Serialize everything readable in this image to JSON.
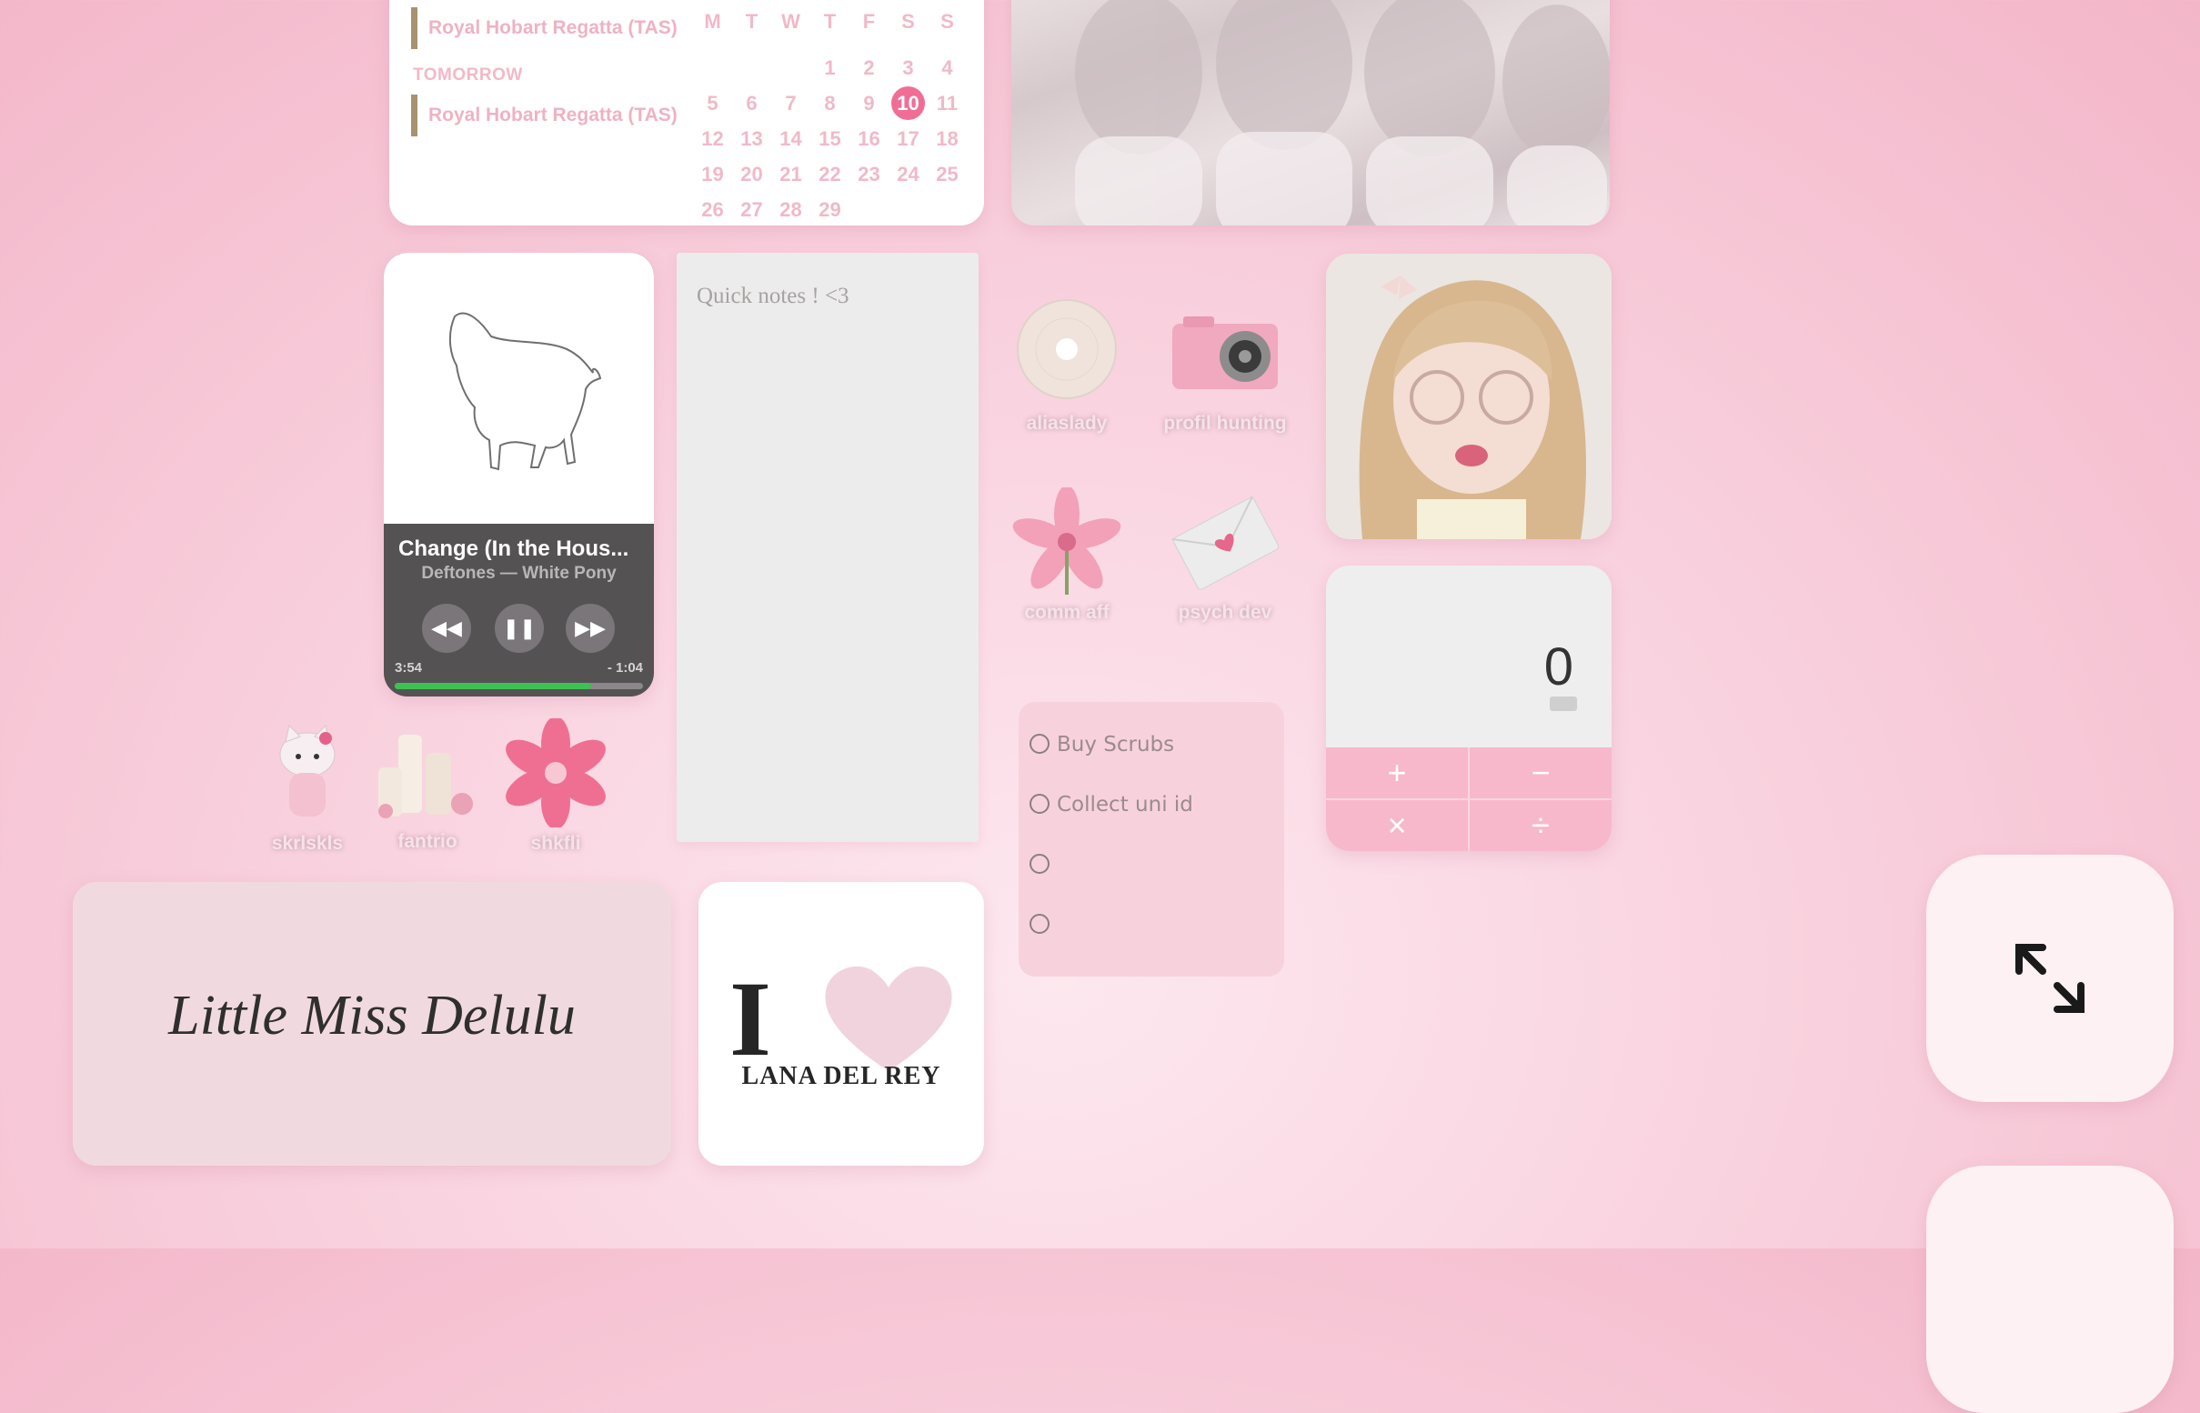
{
  "calendar": {
    "weekdays": [
      "M",
      "T",
      "W",
      "T",
      "F",
      "S",
      "S"
    ],
    "days": [
      "",
      "",
      "",
      "1",
      "2",
      "3",
      "4",
      "5",
      "6",
      "7",
      "8",
      "9",
      "10",
      "11",
      "12",
      "13",
      "14",
      "15",
      "16",
      "17",
      "18",
      "19",
      "20",
      "21",
      "22",
      "23",
      "24",
      "25",
      "26",
      "27",
      "28",
      "29"
    ],
    "today": "10",
    "events": [
      {
        "title": "Royal Hobart Regatta (TAS)"
      },
      {
        "label": "TOMORROW"
      },
      {
        "title": "Royal Hobart Regatta (TAS)"
      }
    ],
    "accent": "#f06e95"
  },
  "music": {
    "song": "Change (In the Hous...",
    "artist": "Deftones — White Pony",
    "elapsed": "3:54",
    "remaining": "- 1:04",
    "progress": 0.79
  },
  "notes": {
    "title": "Quick notes ! <3"
  },
  "apps_right": [
    {
      "label": "aliaslady",
      "icon": "cd-icon"
    },
    {
      "label": "profil hunting",
      "icon": "camera-icon"
    },
    {
      "label": "comm aff",
      "icon": "lily-icon"
    },
    {
      "label": "psych dev",
      "icon": "envelope-icon"
    }
  ],
  "apps_left": [
    {
      "label": "skrlskls",
      "icon": "hello-kitty-icon"
    },
    {
      "label": "fantrio",
      "icon": "candles-icon"
    },
    {
      "label": "shkfli",
      "icon": "flower-icon"
    }
  ],
  "todo": {
    "items": [
      "Buy Scrubs",
      "Collect uni id",
      "",
      ""
    ]
  },
  "calculator": {
    "display": "0",
    "keys": [
      "+",
      "−",
      "×",
      "÷"
    ]
  },
  "delulu": {
    "text": "Little Miss Delulu"
  },
  "lana": {
    "i": "I",
    "name": "LANA DEL REY"
  },
  "colors": {
    "background": "#f6c6d6",
    "todo_bg": "#f7d2dd",
    "calc_pad": "#f7b8cb",
    "progress": "#3cc152"
  }
}
